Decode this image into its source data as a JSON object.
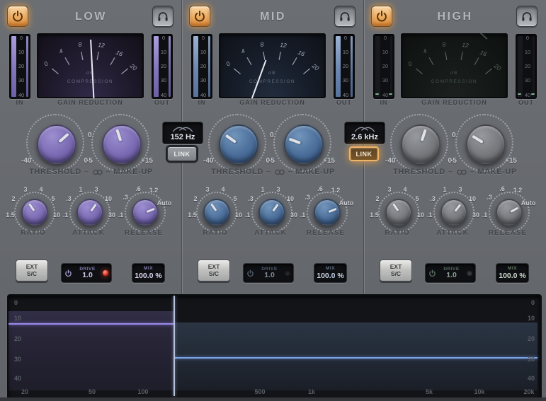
{
  "labels": {
    "separator": "–"
  },
  "bands": [
    {
      "id": "low",
      "title": "LOW",
      "power_on": true,
      "in_label": "IN",
      "out_label": "OUT",
      "gain_reduction_label": "GAIN REDUCTION",
      "meter_scale": [
        "0",
        "10",
        "20",
        "30",
        "40"
      ],
      "vu": {
        "scale": [
          "0",
          "4",
          "8",
          "12",
          "16",
          "20"
        ],
        "unit_line1": "dB",
        "unit_line2": "COMPRESSION",
        "needle_deg": -3
      },
      "threshold": {
        "label": "THRESHOLD",
        "min": "-40",
        "max": "0",
        "deg": 48
      },
      "makeup": {
        "label": "MAKE-UP",
        "min": "-5",
        "max": "+15",
        "zero": "0",
        "deg": -18
      },
      "ratio": {
        "label": "RATIO",
        "ticks": [
          "1.5",
          "2",
          "3",
          "4",
          "5",
          "10"
        ],
        "deg": -35
      },
      "attack": {
        "label": "ATTACK",
        "ticks": [
          ".1",
          ".3",
          "1",
          "3",
          "10",
          "30"
        ],
        "deg": 35
      },
      "release": {
        "label": "RELEASE",
        "ticks": [
          ".1",
          ".3",
          ".6",
          "1.2",
          "Auto"
        ],
        "deg": 68
      },
      "ext_sc": {
        "line1": "EXT",
        "line2": "S/C"
      },
      "drive": {
        "label": "DRIVE",
        "value": "1.0",
        "led_on": true
      },
      "mix": {
        "label": "MIX",
        "value": "100.0 %"
      },
      "accent": "#7a6ab3"
    },
    {
      "id": "mid",
      "title": "MID",
      "power_on": true,
      "in_label": "IN",
      "out_label": "OUT",
      "gain_reduction_label": "GAIN REDUCTION",
      "meter_scale": [
        "0",
        "10",
        "20",
        "30",
        "40"
      ],
      "vu": {
        "scale": [
          "0",
          "4",
          "8",
          "12",
          "16",
          "20"
        ],
        "unit_line1": "dB",
        "unit_line2": "COMPRESSION",
        "needle_deg": 20
      },
      "threshold": {
        "label": "THRESHOLD",
        "min": "-40",
        "max": "0",
        "deg": -55
      },
      "makeup": {
        "label": "MAKE-UP",
        "min": "-5",
        "max": "+15",
        "zero": "0",
        "deg": -70
      },
      "ratio": {
        "label": "RATIO",
        "ticks": [
          "1.5",
          "2",
          "3",
          "4",
          "5",
          "10"
        ],
        "deg": -35
      },
      "attack": {
        "label": "ATTACK",
        "ticks": [
          ".1",
          ".3",
          "1",
          "3",
          "10",
          "30"
        ],
        "deg": 35
      },
      "release": {
        "label": "RELEASE",
        "ticks": [
          ".1",
          ".3",
          ".6",
          "1.2",
          "Auto"
        ],
        "deg": 68
      },
      "ext_sc": {
        "line1": "EXT",
        "line2": "S/C"
      },
      "drive": {
        "label": "DRIVE",
        "value": "1.0",
        "led_on": false
      },
      "mix": {
        "label": "MIX",
        "value": "100.0 %"
      },
      "accent": "#4a6d99"
    },
    {
      "id": "high",
      "title": "HIGH",
      "power_on": true,
      "in_label": "IN",
      "out_label": "OUT",
      "gain_reduction_label": "GAIN REDUCTION",
      "meter_scale": [
        "0",
        "10",
        "20",
        "30",
        "40"
      ],
      "vu": {
        "scale": [
          "0",
          "4",
          "8",
          "12",
          "16",
          "20"
        ],
        "unit_line1": "dB",
        "unit_line2": "COMPRESSION",
        "needle_deg": -48
      },
      "threshold": {
        "label": "THRESHOLD",
        "min": "-40",
        "max": "0",
        "deg": 18
      },
      "makeup": {
        "label": "MAKE-UP",
        "min": "-5",
        "max": "+15",
        "zero": "0",
        "deg": -58
      },
      "ratio": {
        "label": "RATIO",
        "ticks": [
          "1.5",
          "2",
          "3",
          "4",
          "5",
          "10"
        ],
        "deg": -35
      },
      "attack": {
        "label": "ATTACK",
        "ticks": [
          ".1",
          ".3",
          "1",
          "3",
          "10",
          "30"
        ],
        "deg": 38
      },
      "release": {
        "label": "RELEASE",
        "ticks": [
          ".1",
          ".3",
          ".6",
          "1.2",
          "Auto"
        ],
        "deg": 62
      },
      "ext_sc": {
        "line1": "EXT",
        "line2": "S/C"
      },
      "drive": {
        "label": "DRIVE",
        "value": "1.0",
        "led_on": false
      },
      "mix": {
        "label": "MIX",
        "value": "100.0 %"
      },
      "accent": "#76787c"
    }
  ],
  "crossovers": [
    {
      "value": "152 Hz",
      "link_label": "LINK",
      "link_active": false
    },
    {
      "value": "2.6 kHz",
      "link_label": "LINK",
      "link_active": true
    }
  ],
  "spectrum": {
    "x_ticks": [
      "20",
      "50",
      "100",
      "500",
      "1k",
      "5k",
      "10k",
      "20k"
    ],
    "y_ticks": [
      "0",
      "10",
      "20",
      "30",
      "40"
    ],
    "crossover_marker": "152 Hz",
    "lines": [
      {
        "band": "low",
        "level_db": 13,
        "color": "#9a8bea"
      },
      {
        "band": "mid",
        "level_db": 29,
        "color": "#7ba3e8"
      }
    ]
  }
}
